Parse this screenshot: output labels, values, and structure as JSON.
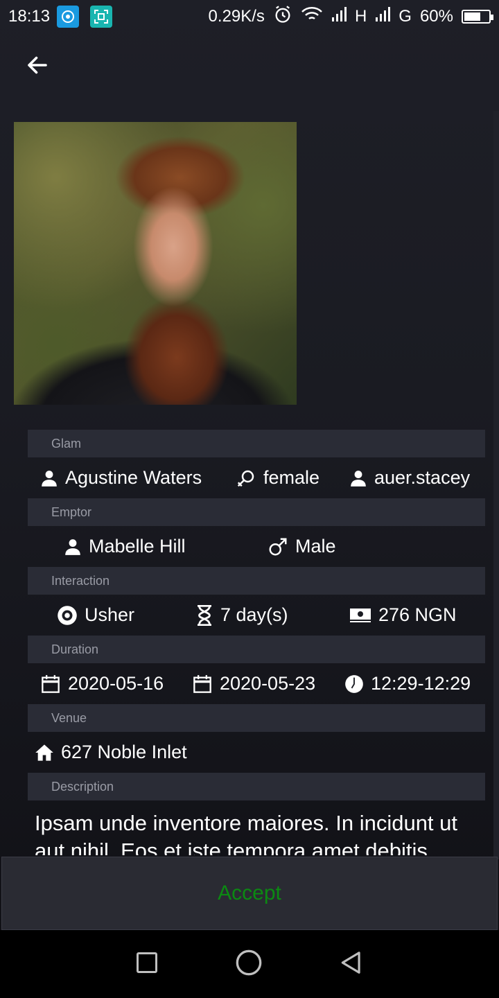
{
  "status_bar": {
    "time": "18:13",
    "speed": "0.29K/s",
    "network_1": "H",
    "network_2": "G",
    "battery": "60%",
    "battery_level": 0.6
  },
  "header": {
    "back_icon": "arrow-left-icon"
  },
  "profile_photo": {
    "icon": "person-photo"
  },
  "sections": {
    "glam": {
      "label": "Glam",
      "name": "Agustine Waters",
      "gender": "female",
      "username": "auer.stacey"
    },
    "emptor": {
      "label": "Emptor",
      "name": "Mabelle Hill",
      "gender": "Male"
    },
    "interaction": {
      "label": "Interaction",
      "role": "Usher",
      "duration": "7 day(s)",
      "price": "276 NGN"
    },
    "duration": {
      "label": "Duration",
      "start_date": "2020-05-16",
      "end_date": "2020-05-23",
      "time_range": "12:29-12:29"
    },
    "venue": {
      "label": "Venue",
      "address": "627 Noble Inlet"
    },
    "description": {
      "label": "Description",
      "text": "Ipsam unde inventore maiores. In incidunt ut aut nihil. Eos et iste tempora amet debitis"
    }
  },
  "actions": {
    "accept_label": "Accept"
  },
  "colors": {
    "accept": "#0b8a12",
    "section_header_bg": "#2a2c36",
    "background": "#1a1b22"
  }
}
